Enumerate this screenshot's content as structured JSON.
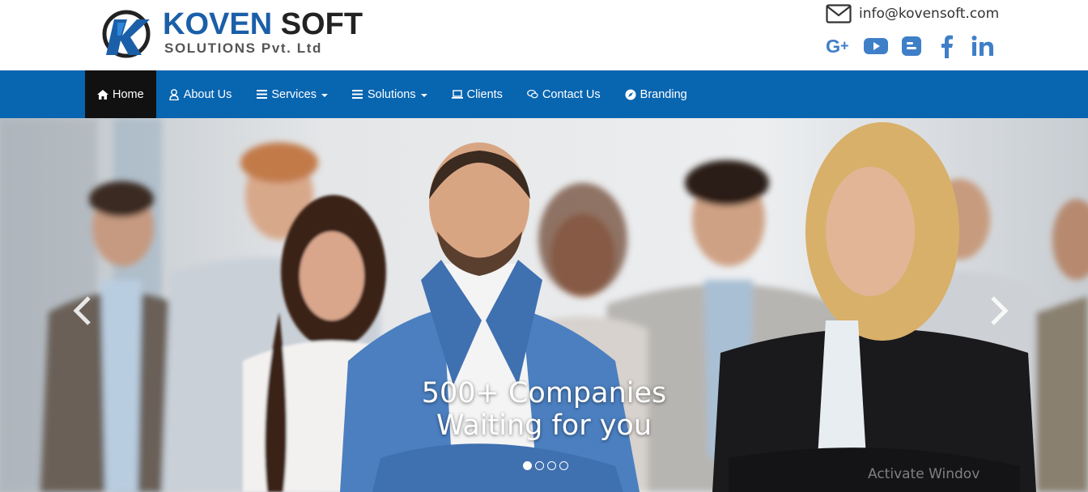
{
  "brand": {
    "name_part1": "KOVEN",
    "name_part2": "SOFT",
    "subtitle": "SOLUTIONS Pvt. Ltd",
    "primary_color": "#1a5fa8",
    "dark_color": "#222222"
  },
  "contact": {
    "email": "info@kovensoft.com",
    "email_icon": "envelope-icon"
  },
  "social": [
    {
      "name": "google-plus-icon"
    },
    {
      "name": "youtube-icon"
    },
    {
      "name": "blogger-icon"
    },
    {
      "name": "facebook-icon"
    },
    {
      "name": "linkedin-icon"
    }
  ],
  "nav": {
    "background": "#0865b0",
    "active_background": "#111111",
    "items": [
      {
        "label": "Home",
        "icon": "home-icon",
        "active": true
      },
      {
        "label": "About Us",
        "icon": "user-icon"
      },
      {
        "label": "Services",
        "icon": "menu-icon",
        "dropdown": true
      },
      {
        "label": "Solutions",
        "icon": "menu-icon",
        "dropdown": true
      },
      {
        "label": "Clients",
        "icon": "laptop-icon"
      },
      {
        "label": "Contact Us",
        "icon": "chat-icon"
      },
      {
        "label": "Branding",
        "icon": "compass-icon"
      }
    ]
  },
  "hero": {
    "caption_line1": "500+ Companies",
    "caption_line2": "Waiting for you",
    "slide_count": 4,
    "active_slide": 1,
    "watermark": "Activate Windov"
  }
}
